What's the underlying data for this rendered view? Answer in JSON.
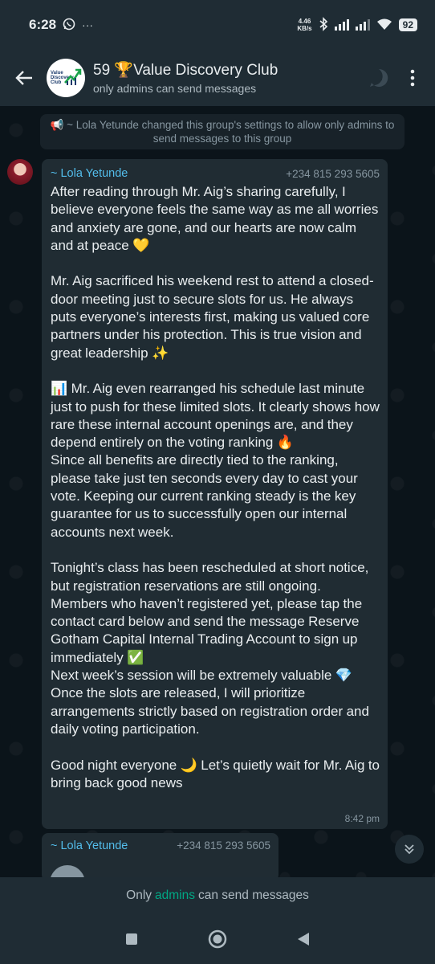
{
  "status_bar": {
    "time": "6:28",
    "extra_icons": "···",
    "netspeed_value": "4.46",
    "netspeed_unit": "KB/s",
    "battery": "92",
    "icons": [
      "whatsapp-icon",
      "bluetooth-icon",
      "signal-icon",
      "signal-icon",
      "wifi-icon",
      "battery-icon"
    ]
  },
  "header": {
    "title": "59 🏆Value Discovery Club",
    "subtitle": "only admins can send messages",
    "avatar_text_1": "Value",
    "avatar_text_2": "Discovery",
    "avatar_text_3": "Club",
    "icons": [
      "back-arrow-icon",
      "voice-chat-icon",
      "more-vert-icon"
    ]
  },
  "system_message": {
    "text": "📢 ~ Lola Yetunde changed this group's settings to allow only admins to send messages to this group"
  },
  "messages": [
    {
      "sender": "~ Lola Yetunde",
      "phone": "+234 815 293 5605",
      "text": "After reading through Mr. Aig’s sharing carefully, I believe everyone feels the same way as me all worries and anxiety are gone, and our hearts are now calm and at peace 💛\n\nMr. Aig sacrificed his weekend rest to attend a closed-door meeting just to secure slots for us. He always puts everyone’s interests first, making us valued core partners under his protection. This is true vision and great leadership ✨\n\n📊 Mr. Aig even rearranged his schedule last minute just to push for these limited slots. It clearly shows how rare these internal account openings are, and they depend entirely on the voting ranking 🔥\nSince all benefits are directly tied to the ranking, please take just ten seconds every day to cast your vote. Keeping our current ranking steady is the key guarantee for us to successfully open our internal accounts next week.\n\nTonight’s class has been rescheduled at short notice, but registration reservations are still ongoing. Members who haven’t registered yet, please tap the contact card below and send the message Reserve Gotham Capital Internal Trading Account to sign up immediately ✅\nNext week’s session will be extremely valuable 💎 Once the slots are released, I will prioritize arrangements strictly based on registration order and daily voting participation.\n\nGood night everyone 🌙 Let’s quietly wait for Mr. Aig to bring back good news",
      "time": "8:42 pm"
    },
    {
      "sender": "~ Lola Yetunde",
      "phone": "+234 815 293 5605"
    }
  ],
  "footer": {
    "prefix": "Only",
    "link": "admins",
    "suffix": "can send messages"
  },
  "navbar": {
    "icons": [
      "recents-icon",
      "home-icon",
      "back-icon"
    ]
  },
  "colors": {
    "background": "#0b141a",
    "bar": "#1f2c34",
    "bubble": "#202c33",
    "sender_name": "#53bdeb",
    "accent": "#00a884"
  }
}
